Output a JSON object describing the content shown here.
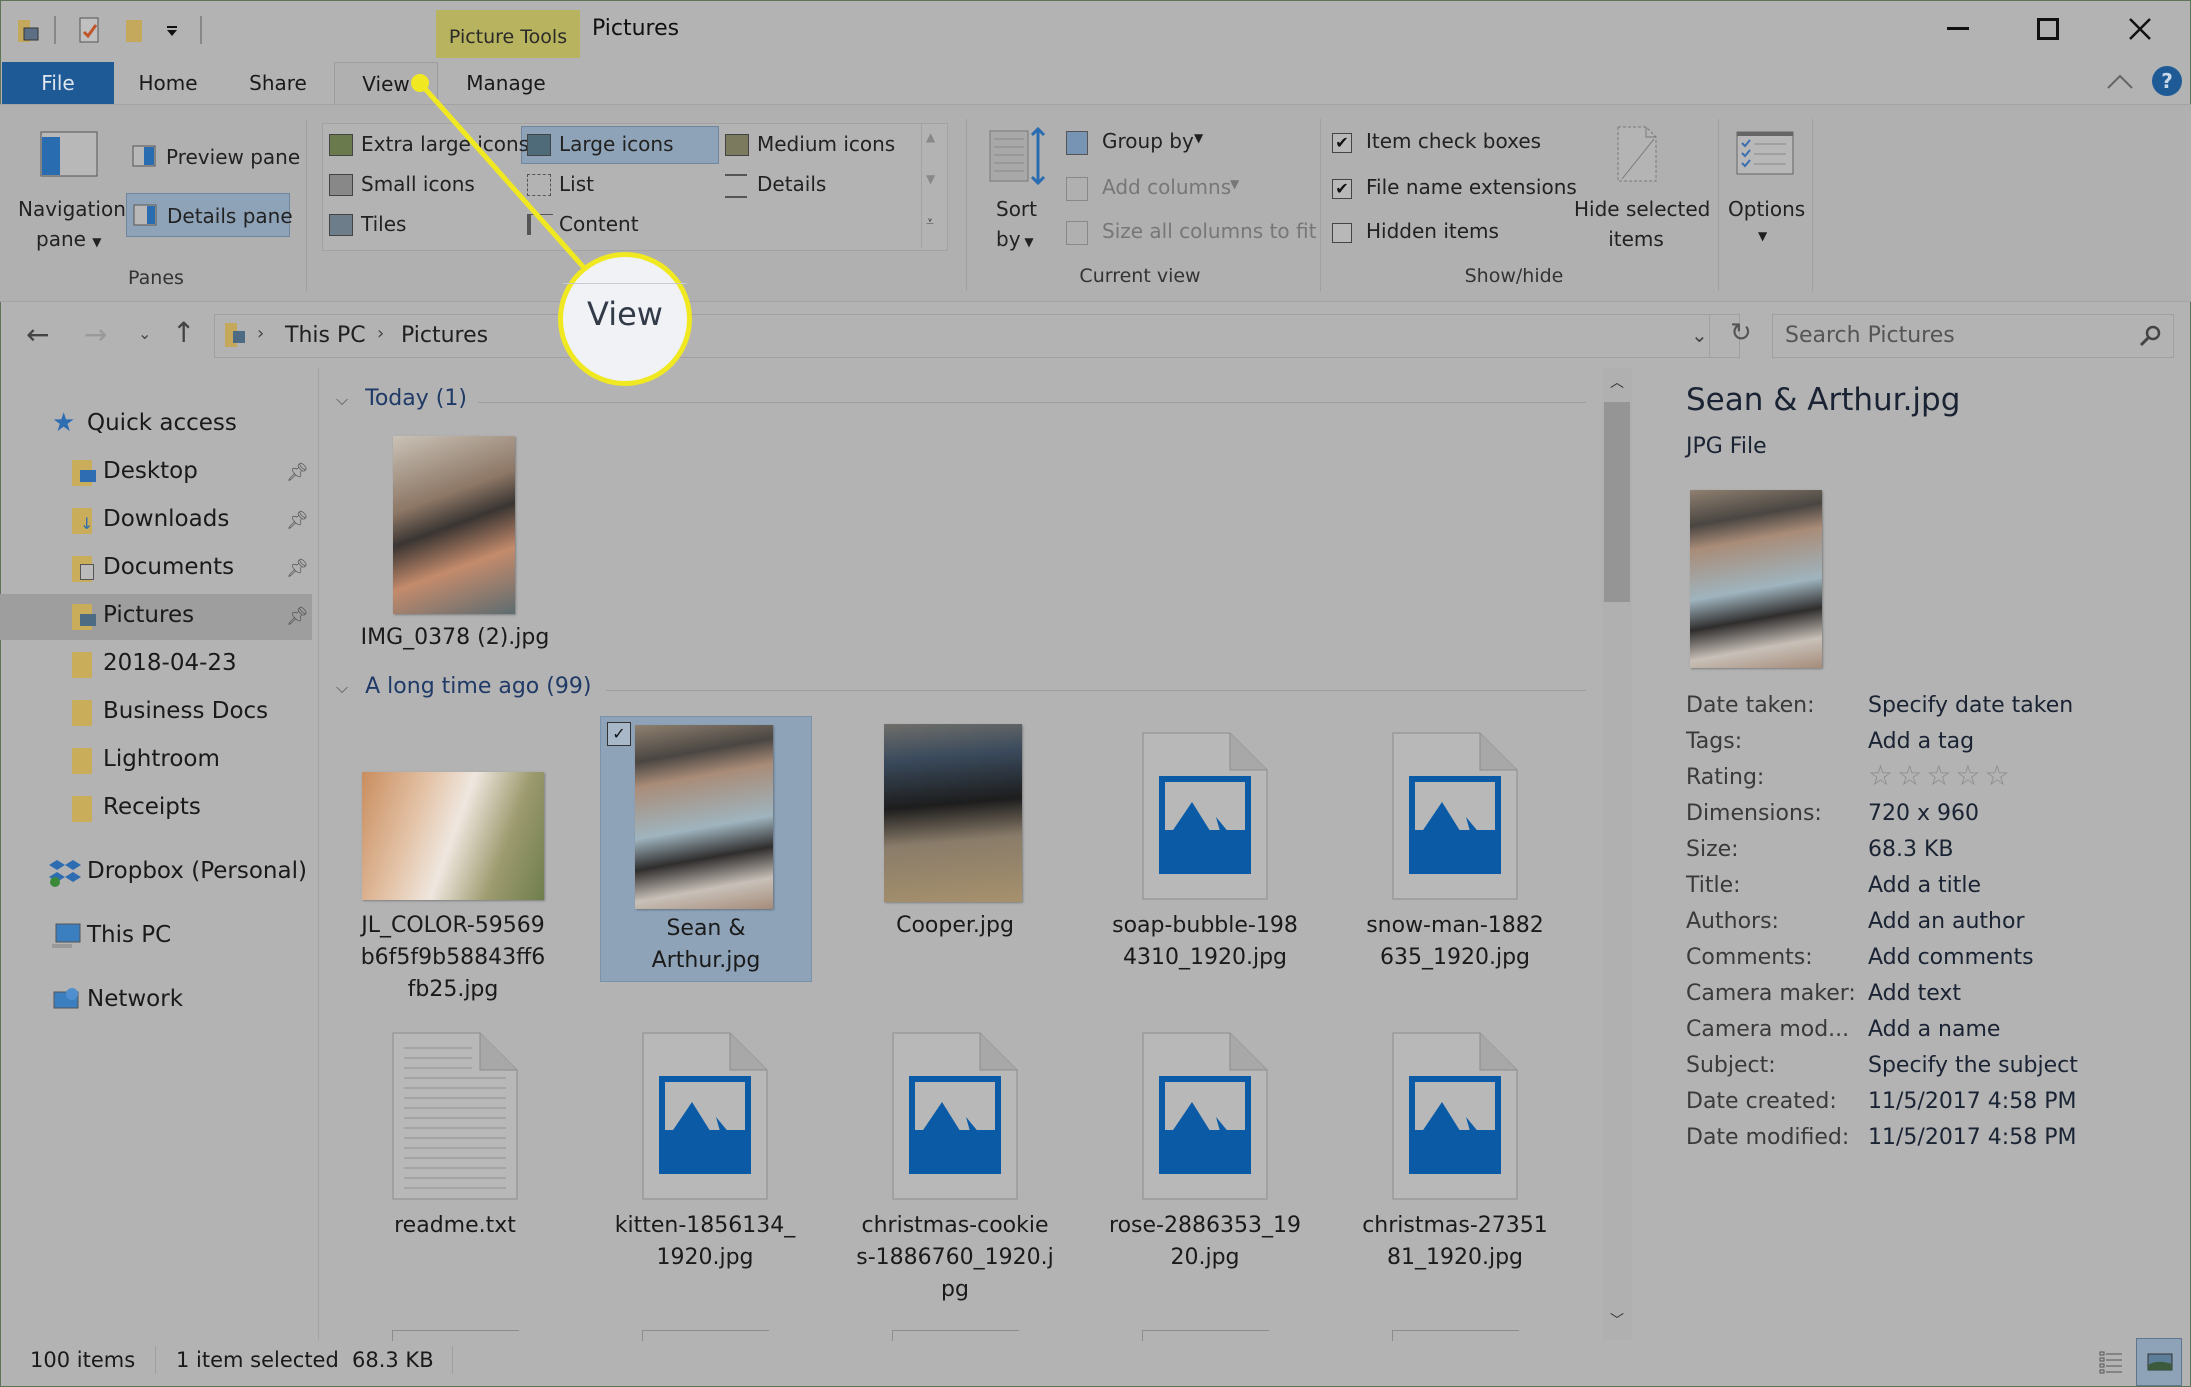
{
  "window": {
    "title": "Pictures",
    "contextual_tab_group": "Picture Tools",
    "controls": {
      "minimize": "minimize-icon",
      "maximize": "maximize-icon",
      "close": "close-icon"
    }
  },
  "quick_access_toolbar": [
    "properties-icon",
    "checkmark-icon",
    "new-folder-icon",
    "customize-dropdown-icon"
  ],
  "tabs": [
    {
      "label": "File",
      "active": false
    },
    {
      "label": "Home",
      "active": false
    },
    {
      "label": "Share",
      "active": false
    },
    {
      "label": "View",
      "active": true
    },
    {
      "label": "Manage",
      "active": false
    }
  ],
  "ribbon": {
    "panes": {
      "navigation_pane": "Navigation",
      "navigation_pane_2": "pane",
      "preview_pane": "Preview pane",
      "details_pane": "Details pane",
      "group_label": "Panes"
    },
    "layout": {
      "options": [
        "Extra large icons",
        "Large icons",
        "Medium icons",
        "Small icons",
        "List",
        "Details",
        "Tiles",
        "Content"
      ],
      "selected": "Large icons"
    },
    "current_view": {
      "sort_by_1": "Sort",
      "sort_by_2": "by",
      "group_by": "Group by",
      "add_columns": "Add columns",
      "size_columns": "Size all columns to fit",
      "group_label": "Current view"
    },
    "show_hide": {
      "item_check_boxes": {
        "label": "Item check boxes",
        "checked": true
      },
      "file_name_extensions": {
        "label": "File name extensions",
        "checked": true
      },
      "hidden_items": {
        "label": "Hidden items",
        "checked": false
      },
      "hide_selected_1": "Hide selected",
      "hide_selected_2": "items",
      "group_label": "Show/hide"
    },
    "options": {
      "label": "Options"
    }
  },
  "address": {
    "breadcrumb": [
      "This PC",
      "Pictures"
    ],
    "search_placeholder": "Search Pictures"
  },
  "nav_pane": {
    "quick_access": "Quick access",
    "pinned": [
      "Desktop",
      "Downloads",
      "Documents",
      "Pictures"
    ],
    "folders": [
      "2018-04-23",
      "Business Docs",
      "Lightroom",
      "Receipts"
    ],
    "dropbox": "Dropbox (Personal)",
    "this_pc": "This PC",
    "network": "Network",
    "selected": "Pictures"
  },
  "content": {
    "groups": [
      {
        "label": "Today (1)",
        "items": [
          {
            "name": "IMG_0378 (2).jpg",
            "type": "photo"
          }
        ]
      },
      {
        "label": "A long time ago (99)",
        "items": [
          {
            "name": "JL_COLOR-59569 b6f5f9b58843ff6 fb25.jpg",
            "line1": "JL_COLOR-59569",
            "line2": "b6f5f9b58843ff6",
            "line3": "fb25.jpg",
            "type": "photo"
          },
          {
            "name": "Sean & Arthur.jpg",
            "line1": "Sean &",
            "line2": "Arthur.jpg",
            "type": "photo",
            "selected": true,
            "checked": true
          },
          {
            "name": "Cooper.jpg",
            "line1": "Cooper.jpg",
            "type": "photo"
          },
          {
            "name": "soap-bubble-1984310_1920.jpg",
            "line1": "soap-bubble-198",
            "line2": "4310_1920.jpg",
            "type": "image-file"
          },
          {
            "name": "snow-man-1882635_1920.jpg",
            "line1": "snow-man-1882",
            "line2": "635_1920.jpg",
            "type": "image-file"
          },
          {
            "name": "readme.txt",
            "line1": "readme.txt",
            "type": "text-file"
          },
          {
            "name": "kitten-1856134_1920.jpg",
            "line1": "kitten-1856134_",
            "line2": "1920.jpg",
            "type": "image-file"
          },
          {
            "name": "christmas-cookies-1886760_1920.jpg",
            "line1": "christmas-cookie",
            "line2": "s-1886760_1920.j",
            "line3": "pg",
            "type": "image-file"
          },
          {
            "name": "rose-2886353_1920.jpg",
            "line1": "rose-2886353_19",
            "line2": "20.jpg",
            "type": "image-file"
          },
          {
            "name": "christmas-2735181_1920.jpg",
            "line1": "christmas-27351",
            "line2": "81_1920.jpg",
            "type": "image-file"
          }
        ]
      }
    ]
  },
  "details_pane": {
    "file_name": "Sean & Arthur.jpg",
    "file_type": "JPG File",
    "properties": [
      {
        "key": "Date taken:",
        "value": "Specify date taken"
      },
      {
        "key": "Tags:",
        "value": "Add a tag"
      },
      {
        "key": "Rating:",
        "value": "",
        "rating": 0,
        "rating_max": 5
      },
      {
        "key": "Dimensions:",
        "value": "720 x 960"
      },
      {
        "key": "Size:",
        "value": "68.3 KB"
      },
      {
        "key": "Title:",
        "value": "Add a title"
      },
      {
        "key": "Authors:",
        "value": "Add an author"
      },
      {
        "key": "Comments:",
        "value": "Add comments"
      },
      {
        "key": "Camera maker:",
        "value": "Add text"
      },
      {
        "key": "Camera mod...",
        "value": "Add a name"
      },
      {
        "key": "Subject:",
        "value": "Specify the subject"
      },
      {
        "key": "Date created:",
        "value": "11/5/2017 4:58 PM"
      },
      {
        "key": "Date modified:",
        "value": "11/5/2017 4:58 PM"
      }
    ]
  },
  "status_bar": {
    "item_count": "100 items",
    "selection": "1 item selected",
    "selection_size": "68.3 KB"
  },
  "callout": {
    "label": "View",
    "color": "#f0e820"
  },
  "colors": {
    "accent_blue": "#1e5a96",
    "picture_tools": "#b8b35e",
    "selection": "#8ea3b8",
    "image_icon_blue": "#0b5aa5"
  }
}
